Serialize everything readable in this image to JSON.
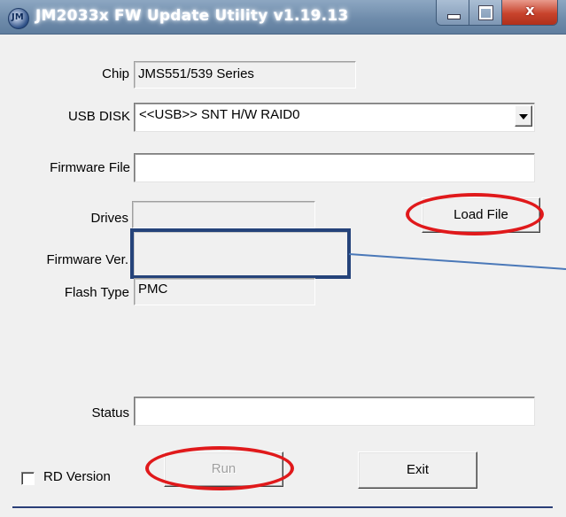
{
  "window": {
    "title": "JM2033x FW Update Utility v1.19.13",
    "app_icon_text": "JM",
    "close_glyph": "x"
  },
  "form": {
    "chip": {
      "label": "Chip",
      "value": "JMS551/539 Series"
    },
    "usb_disk": {
      "label": "USB DISK",
      "selected": "<<USB>> SNT H/W RAID0"
    },
    "firmware_file": {
      "label": "Firmware File",
      "value": ""
    },
    "drives": {
      "label": "Drives",
      "value": ""
    },
    "firmware_ver": {
      "label": "Firmware Ver.",
      "value": ""
    },
    "flash_type": {
      "label": "Flash Type",
      "value": "PMC"
    },
    "status": {
      "label": "Status",
      "value": ""
    },
    "rd_version": {
      "label": "RD Version",
      "checked": false
    }
  },
  "buttons": {
    "load_file": "Load File",
    "run": "Run",
    "exit": "Exit"
  },
  "annotations": {
    "ellipse_color": "#e0191b",
    "rect_color": "#25437a",
    "line_color": "#4a78b8"
  },
  "icons": [
    "jmicron-app-icon",
    "minimize-icon",
    "maximize-icon",
    "close-icon",
    "dropdown-arrow-icon"
  ]
}
